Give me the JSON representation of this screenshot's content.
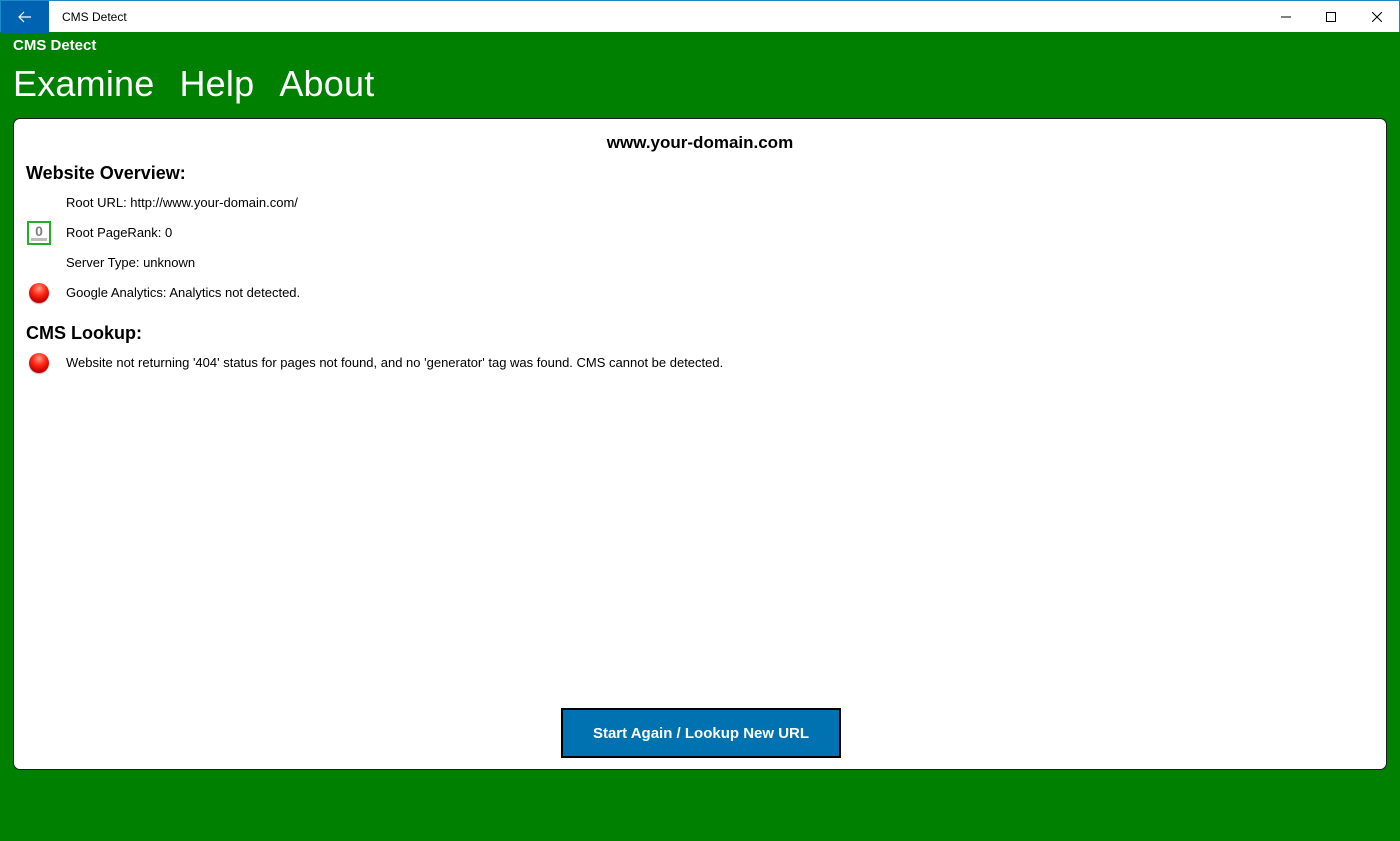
{
  "window": {
    "title": "CMS Detect"
  },
  "app": {
    "name": "CMS Detect"
  },
  "nav": {
    "items": [
      {
        "label": "Examine"
      },
      {
        "label": "Help"
      },
      {
        "label": "About"
      }
    ]
  },
  "report": {
    "domain": "www.your-domain.com",
    "overview": {
      "heading": "Website Overview:",
      "root_url": "Root URL: http://www.your-domain.com/",
      "pagerank_badge": "0",
      "pagerank": "Root PageRank: 0",
      "server_type": "Server Type: unknown",
      "analytics": "Google Analytics: Analytics not detected."
    },
    "cms": {
      "heading": "CMS Lookup:",
      "result": "Website not returning '404' status for pages not found, and no 'generator' tag was found. CMS cannot be detected."
    }
  },
  "actions": {
    "start_again": "Start Again / Lookup New URL"
  },
  "colors": {
    "app_background": "#008000",
    "back_button": "#0063b1",
    "action_button": "#0072b1",
    "status_bad": "#e00000",
    "pagerank_border": "#22b022"
  },
  "icons": {
    "back": "arrow-left-icon",
    "minimize": "minimize-icon",
    "maximize": "maximize-icon",
    "close": "close-icon",
    "status": "red-status-icon",
    "pagerank": "pagerank-icon"
  }
}
